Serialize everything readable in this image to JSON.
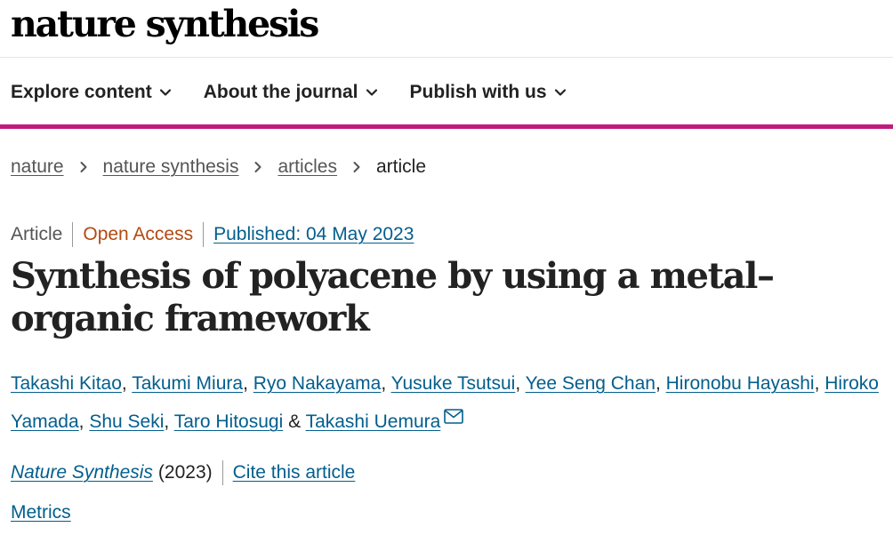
{
  "brand": {
    "logo_text": "nature synthesis"
  },
  "nav": {
    "items": [
      {
        "label": "Explore content"
      },
      {
        "label": "About the journal"
      },
      {
        "label": "Publish with us"
      }
    ]
  },
  "breadcrumb": {
    "items": [
      "nature",
      "nature synthesis",
      "articles"
    ],
    "current": "article"
  },
  "article": {
    "type": "Article",
    "access": "Open Access",
    "published": "Published: 04 May 2023",
    "title": "Synthesis of polyacene by using a metal–organic framework",
    "authors": [
      "Takashi Kitao",
      "Takumi Miura",
      "Ryo Nakayama",
      "Yusuke Tsutsui",
      "Yee Seng Chan",
      "Hironobu Hayashi",
      "Hiroko Yamada",
      "Shu Seki",
      "Taro Hitosugi",
      "Takashi Uemura"
    ],
    "author_separator": ", ",
    "author_last_separator": " & ",
    "journal": "Nature Synthesis",
    "year": "(2023)",
    "cite_label": "Cite this article",
    "metrics_label": "Metrics"
  },
  "colors": {
    "accent_pink": "#c01b7e",
    "link_blue": "#025e8d",
    "open_access_orange": "#b44911"
  },
  "icons": {
    "nav_chevron": "chevron-down-icon",
    "breadcrumb_separator": "chevron-right-icon",
    "corresponding_author": "envelope-icon"
  }
}
